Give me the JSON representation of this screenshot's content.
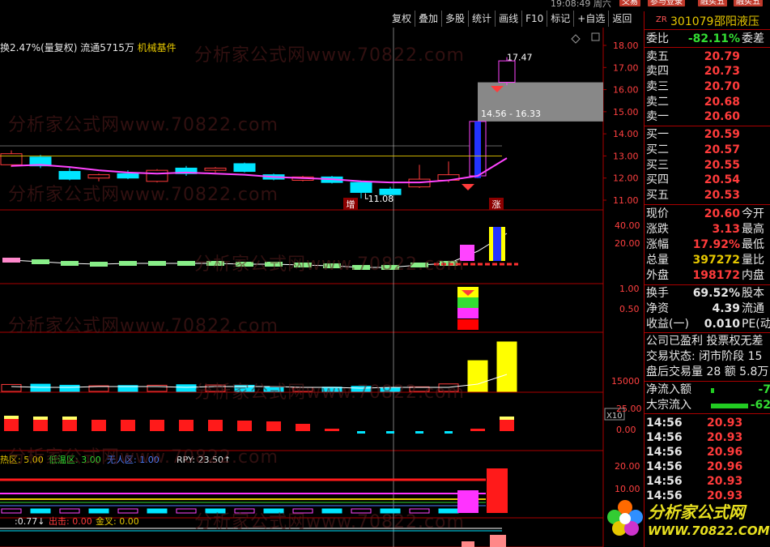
{
  "topbar": {
    "clock": "19:08:49 周六",
    "tabs": [
      "交易",
      "参与登录",
      "融买五",
      "融买五"
    ],
    "menu": [
      "复权",
      "叠加",
      "多股",
      "统计",
      "画线",
      "F10",
      "标记",
      "+自选",
      "返回"
    ]
  },
  "infoline": {
    "text": "换2.47%(量复权) 流通5715万",
    "sector": "机械基件"
  },
  "watermarks": [
    "分析家公式网www.70822.com"
  ],
  "main_chart": {
    "y_ticks": [
      "18.00",
      "17.00",
      "16.00",
      "15.00",
      "14.00",
      "13.00",
      "12.00",
      "11.00"
    ],
    "annotations": {
      "high": "17.47",
      "range": "14.56 - 16.33",
      "low": "11.08",
      "badge_left": "增",
      "badge_right": "涨"
    }
  },
  "sub_charts": {
    "p2_ticks": [
      "40.00",
      "20.00"
    ],
    "p3_ticks": [
      "1.00",
      "0.50"
    ],
    "p4_tick": "15000",
    "p4_unit": "X10",
    "p5_ticks": [
      "25.00",
      "0.00"
    ],
    "p6_ticks": [
      "20.00",
      "10.00"
    ],
    "p6_legend": {
      "hot": "热区: 5.00",
      "cool": "低温区: 3.00",
      "none": "无人区: 1.00",
      "rpy": "RPY: 23.50↑"
    },
    "p7_legend": {
      "a": ":0.77↓",
      "b": "出击: 0.00",
      "c": "金叉: 0.00"
    }
  },
  "sidebar": {
    "zr": "ZR",
    "code": "301079",
    "name": "邵阳液压",
    "weibi": {
      "label": "委比",
      "value": "-82.11%",
      "ext": "委差"
    },
    "asks": [
      {
        "label": "卖五",
        "price": "20.79"
      },
      {
        "label": "卖四",
        "price": "20.73"
      },
      {
        "label": "卖三",
        "price": "20.70"
      },
      {
        "label": "卖二",
        "price": "20.68"
      },
      {
        "label": "卖一",
        "price": "20.60"
      }
    ],
    "bids": [
      {
        "label": "买一",
        "price": "20.59"
      },
      {
        "label": "买二",
        "price": "20.57"
      },
      {
        "label": "买三",
        "price": "20.55"
      },
      {
        "label": "买四",
        "price": "20.54"
      },
      {
        "label": "买五",
        "price": "20.53"
      }
    ],
    "quote": [
      {
        "label": "现价",
        "value": "20.60",
        "ext": "今开",
        "color": "red"
      },
      {
        "label": "涨跌",
        "value": "3.13",
        "ext": "最高",
        "color": "red"
      },
      {
        "label": "涨幅",
        "value": "17.92%",
        "ext": "最低",
        "color": "red"
      },
      {
        "label": "总量",
        "value": "397272",
        "ext": "量比",
        "color": "yel"
      },
      {
        "label": "外盘",
        "value": "198172",
        "ext": "内盘",
        "color": "red"
      }
    ],
    "stats": [
      {
        "label": "换手",
        "value": "69.52%",
        "ext": "股本"
      },
      {
        "label": "净资",
        "value": "4.39",
        "ext": "流通"
      },
      {
        "label": "收益(一)",
        "value": "0.010",
        "ext": "PE(动"
      }
    ],
    "notes": [
      "公司已盈利 投票权无差",
      "交易状态: 闭市阶段 15",
      "盘后交易量 28 额 5.8万"
    ],
    "flows": [
      {
        "label": "净流入额",
        "value": "-7"
      },
      {
        "label": "大宗流入",
        "value": "-62"
      }
    ],
    "ticks": [
      {
        "time": "14:56",
        "price": "20.93"
      },
      {
        "time": "14:56",
        "price": "20.93"
      },
      {
        "time": "14:56",
        "price": "20.96"
      },
      {
        "time": "14:56",
        "price": "20.96"
      },
      {
        "time": "14:56",
        "price": "20.93"
      },
      {
        "time": "14:56",
        "price": "20.93"
      }
    ]
  },
  "logo": {
    "title": "分析家公式网",
    "url": "WWW.70822.COM"
  },
  "colors": {
    "bg": "#000000",
    "up": "#ff3b3b",
    "down": "#00e5ff",
    "ma": "#ff44ff",
    "accent": "#e6c700",
    "grid": "#aa0000"
  },
  "candles": [
    {
      "o": 12.6,
      "c": 13.1,
      "h": 13.25,
      "l": 12.5
    },
    {
      "o": 12.95,
      "c": 12.55,
      "h": 13.05,
      "l": 12.45
    },
    {
      "o": 12.3,
      "c": 11.95,
      "h": 12.45,
      "l": 11.9
    },
    {
      "o": 12.0,
      "c": 12.15,
      "h": 12.2,
      "l": 11.85
    },
    {
      "o": 12.2,
      "c": 12.0,
      "h": 12.35,
      "l": 11.95
    },
    {
      "o": 11.85,
      "c": 12.35,
      "h": 12.4,
      "l": 11.8
    },
    {
      "o": 12.45,
      "c": 12.2,
      "h": 12.55,
      "l": 12.1
    },
    {
      "o": 12.35,
      "c": 12.45,
      "h": 12.5,
      "l": 12.25
    },
    {
      "o": 12.65,
      "c": 12.3,
      "h": 12.7,
      "l": 12.25
    },
    {
      "o": 12.15,
      "c": 11.95,
      "h": 12.2,
      "l": 11.9
    },
    {
      "o": 11.9,
      "c": 12.05,
      "h": 12.1,
      "l": 11.85
    },
    {
      "o": 12.05,
      "c": 11.8,
      "h": 12.1,
      "l": 11.75
    },
    {
      "o": 11.8,
      "c": 11.35,
      "h": 11.85,
      "l": 11.08
    },
    {
      "o": 11.5,
      "c": 11.25,
      "h": 11.6,
      "l": 11.15
    },
    {
      "o": 11.6,
      "c": 11.95,
      "h": 12.6,
      "l": 11.55
    },
    {
      "o": 11.9,
      "c": 12.15,
      "h": 12.75,
      "l": 11.8
    },
    {
      "o": 12.1,
      "c": 14.56,
      "h": 14.56,
      "l": 12.0
    },
    {
      "o": 16.33,
      "c": 17.3,
      "h": 17.47,
      "l": 16.2
    }
  ],
  "volumes": [
    2600,
    2700,
    2300,
    2100,
    2200,
    2300,
    2500,
    2400,
    2300,
    1600,
    1500,
    1600,
    1900,
    1400,
    1700,
    2800,
    11500,
    18500
  ]
}
